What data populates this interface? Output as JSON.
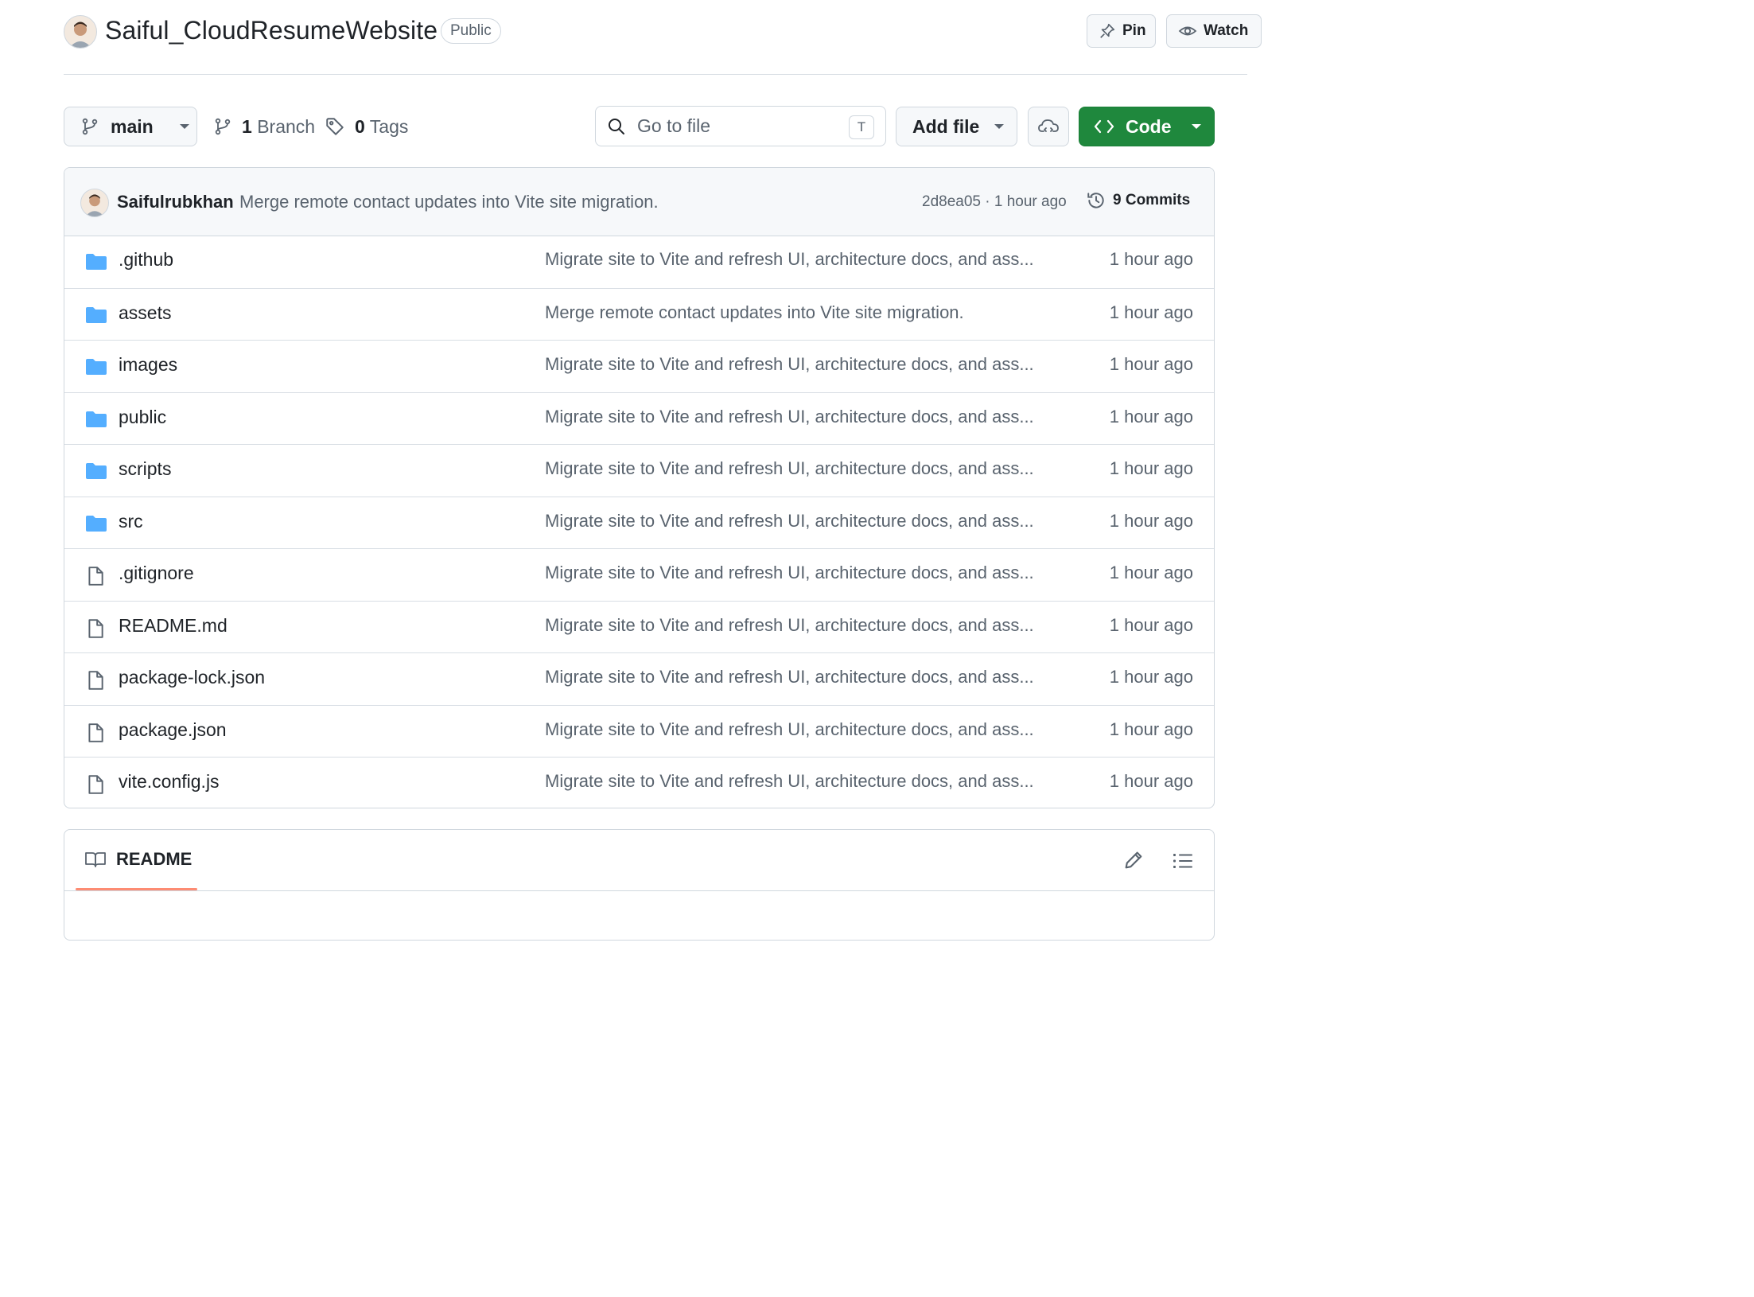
{
  "repo": {
    "name": "Saiful_CloudResumeWebsite",
    "visibility": "Public",
    "pin_label": "Pin",
    "watch_label": "Watch"
  },
  "toolbar": {
    "branch": "main",
    "branches_count": "1",
    "branches_label": "Branch",
    "tags_count": "0",
    "tags_label": "Tags",
    "search_placeholder": "Go to file",
    "search_shortcut": "T",
    "add_file_label": "Add file",
    "code_label": "Code"
  },
  "latest_commit": {
    "author": "Saifulrubkhan",
    "message": "Merge remote contact updates into Vite site migration.",
    "meta": "2d8ea05 · 1 hour ago",
    "commits_label": "9 Commits"
  },
  "files": [
    {
      "name": ".github",
      "type": "folder",
      "message": "Migrate site to Vite and refresh UI, architecture docs, and ass...",
      "age": "1 hour ago"
    },
    {
      "name": "assets",
      "type": "folder",
      "message": "Merge remote contact updates into Vite site migration.",
      "age": "1 hour ago"
    },
    {
      "name": "images",
      "type": "folder",
      "message": "Migrate site to Vite and refresh UI, architecture docs, and ass...",
      "age": "1 hour ago"
    },
    {
      "name": "public",
      "type": "folder",
      "message": "Migrate site to Vite and refresh UI, architecture docs, and ass...",
      "age": "1 hour ago"
    },
    {
      "name": "scripts",
      "type": "folder",
      "message": "Migrate site to Vite and refresh UI, architecture docs, and ass...",
      "age": "1 hour ago"
    },
    {
      "name": "src",
      "type": "folder",
      "message": "Migrate site to Vite and refresh UI, architecture docs, and ass...",
      "age": "1 hour ago"
    },
    {
      "name": ".gitignore",
      "type": "file",
      "message": "Migrate site to Vite and refresh UI, architecture docs, and ass...",
      "age": "1 hour ago"
    },
    {
      "name": "README.md",
      "type": "file",
      "message": "Migrate site to Vite and refresh UI, architecture docs, and ass...",
      "age": "1 hour ago"
    },
    {
      "name": "package-lock.json",
      "type": "file",
      "message": "Migrate site to Vite and refresh UI, architecture docs, and ass...",
      "age": "1 hour ago"
    },
    {
      "name": "package.json",
      "type": "file",
      "message": "Migrate site to Vite and refresh UI, architecture docs, and ass...",
      "age": "1 hour ago"
    },
    {
      "name": "vite.config.js",
      "type": "file",
      "message": "Migrate site to Vite and refresh UI, architecture docs, and ass...",
      "age": "1 hour ago"
    }
  ],
  "readme": {
    "tab_label": "README"
  },
  "icons": {
    "folder": "folder-icon",
    "file": "file-icon",
    "branch": "git-branch-icon",
    "tag": "tag-icon",
    "search": "search-icon",
    "history": "history-icon",
    "pin": "pin-icon",
    "eye": "eye-icon",
    "book": "book-icon",
    "pencil": "pencil-icon",
    "outline": "list-unordered-icon",
    "cloud": "cloud-icon",
    "code": "code-icon"
  },
  "colors": {
    "accent_green": "#1f883d",
    "folder_blue": "#54aeff",
    "muted_text": "#59636e",
    "readme_underline": "#fd8c73"
  }
}
